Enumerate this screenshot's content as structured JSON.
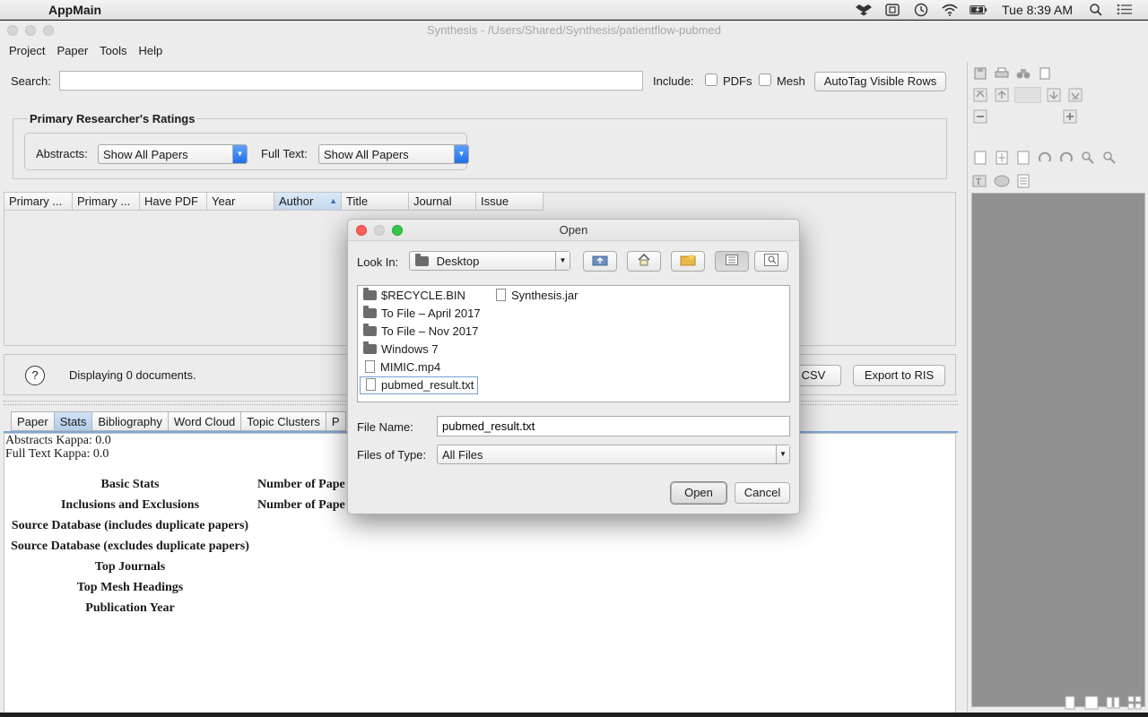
{
  "menubar": {
    "app_name": "AppMain",
    "clock": "Tue 8:39 AM"
  },
  "window": {
    "title": "Synthesis - /Users/Shared/Synthesis/patientflow-pubmed",
    "menus": [
      "Project",
      "Paper",
      "Tools",
      "Help"
    ]
  },
  "search": {
    "label": "Search:",
    "value": "",
    "include_label": "Include:",
    "pdfs_label": "PDFs",
    "mesh_label": "Mesh",
    "pdfs_checked": false,
    "mesh_checked": false,
    "autotag_label": "AutoTag Visible Rows"
  },
  "ratings": {
    "title": "Primary Researcher's  Ratings",
    "abstracts_label": "Abstracts:",
    "abstracts_value": "Show All Papers",
    "fulltext_label": "Full Text:",
    "fulltext_value": "Show All Papers"
  },
  "table": {
    "columns": [
      "Primary ...",
      "Primary ...",
      "Have PDF",
      "Year",
      "Author",
      "Title",
      "Journal",
      "Issue"
    ],
    "sorted_column": "Author",
    "rows": []
  },
  "status": {
    "text": "Displaying 0 documents.",
    "export_csv": "o CSV",
    "export_ris": "Export to RIS"
  },
  "tabs": [
    "Paper",
    "Stats",
    "Bibliography",
    "Word Cloud",
    "Topic Clusters",
    "P"
  ],
  "active_tab": "Stats",
  "stats": {
    "abstracts_kappa": "Abstracts Kappa: 0.0",
    "fulltext_kappa": "Full Text Kappa: 0.0",
    "rows": [
      {
        "label": "Basic Stats",
        "col2": "Number of Pape"
      },
      {
        "label": "Inclusions and Exclusions",
        "col2": "Number of Pape"
      },
      {
        "label": "Source Database (includes duplicate papers)",
        "col2": ""
      },
      {
        "label": "Source Database (excludes duplicate papers)",
        "col2": ""
      },
      {
        "label": "Top Journals",
        "col2": ""
      },
      {
        "label": "Top Mesh Headings",
        "col2": ""
      },
      {
        "label": "Publication Year",
        "col2": ""
      }
    ]
  },
  "dialog": {
    "title": "Open",
    "look_in_label": "Look In:",
    "look_in_value": "Desktop",
    "files": [
      {
        "name": "$RECYCLE.BIN",
        "type": "folder"
      },
      {
        "name": "To File – April 2017",
        "type": "folder"
      },
      {
        "name": "To File – Nov 2017",
        "type": "folder"
      },
      {
        "name": "Windows 7",
        "type": "folder"
      },
      {
        "name": "MIMIC.mp4",
        "type": "file"
      },
      {
        "name": "pubmed_result.txt",
        "type": "file",
        "selected": true
      },
      {
        "name": "Synthesis.jar",
        "type": "file"
      }
    ],
    "file_name_label": "File Name:",
    "file_name_value": "pubmed_result.txt",
    "file_type_label": "Files of Type:",
    "file_type_value": "All Files",
    "open_label": "Open",
    "cancel_label": "Cancel"
  },
  "colors": {
    "accent": "#1f6fe8",
    "close": "#fc605c",
    "maximize": "#34c84a",
    "viewer_bg": "#919191"
  }
}
